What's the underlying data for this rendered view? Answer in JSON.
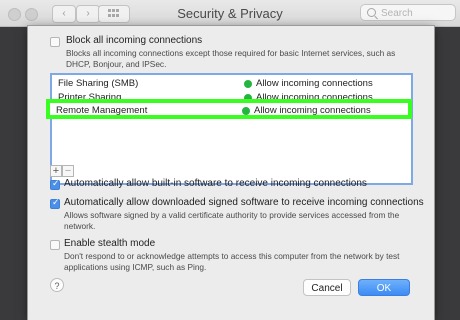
{
  "window": {
    "title": "Security & Privacy",
    "search_placeholder": "Search"
  },
  "toolbar": {
    "back_icon": "chevron-left-icon",
    "forward_icon": "chevron-right-icon",
    "grid_icon": "grid-icon"
  },
  "sheet": {
    "block_all": {
      "label": "Block all incoming connections",
      "description": "Blocks all incoming connections except those required for basic Internet services, such as DHCP, Bonjour, and IPSec.",
      "checked": false
    },
    "services": [
      {
        "name": "File Sharing (SMB)",
        "status": "Allow incoming connections",
        "status_color": "#26b440"
      },
      {
        "name": "Printer Sharing",
        "status": "Allow incoming connections",
        "status_color": "#26b440"
      },
      {
        "name": "Remote Management",
        "status": "Allow incoming connections",
        "status_color": "#26b440",
        "highlighted": true
      }
    ],
    "add_label": "+",
    "remove_label": "−",
    "auto_builtin": {
      "label": "Automatically allow built-in software to receive incoming connections",
      "checked": true
    },
    "auto_signed": {
      "label": "Automatically allow downloaded signed software to receive incoming connections",
      "description": "Allows software signed by a valid certificate authority to provide services accessed from the network.",
      "checked": true
    },
    "stealth": {
      "label": "Enable stealth mode",
      "description": "Don't respond to or acknowledge attempts to access this computer from the network by test applications using ICMP, such as Ping.",
      "checked": false
    },
    "help_label": "?",
    "cancel_label": "Cancel",
    "ok_label": "OK"
  },
  "colors": {
    "accent": "#3c8cf4",
    "highlight": "#38ff1f",
    "status_green": "#26b440"
  }
}
